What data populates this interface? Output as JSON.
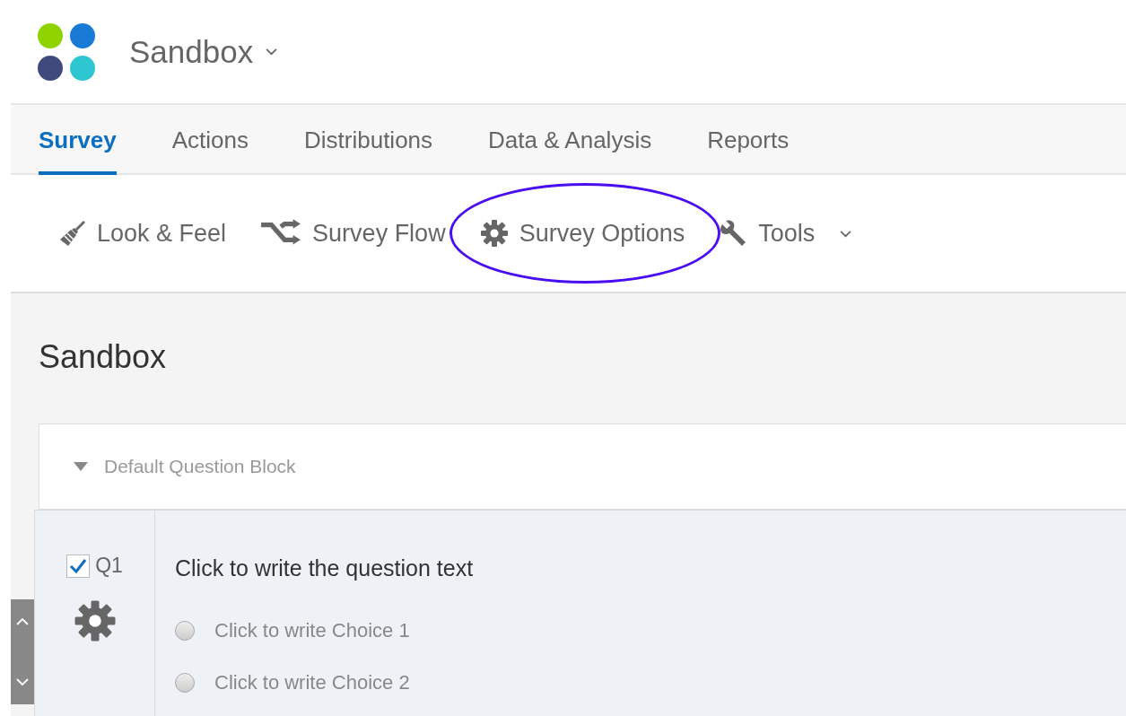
{
  "project": {
    "title": "Sandbox",
    "dropdown": true
  },
  "tabs": [
    {
      "label": "Survey",
      "selected": true
    },
    {
      "label": "Actions",
      "selected": false
    },
    {
      "label": "Distributions",
      "selected": false
    },
    {
      "label": "Data & Analysis",
      "selected": false
    },
    {
      "label": "Reports",
      "selected": false
    }
  ],
  "toolbar": [
    {
      "kind": "brush",
      "label": "Look & Feel",
      "circled": false,
      "dropdown": false
    },
    {
      "kind": "flow",
      "label": "Survey Flow",
      "circled": false,
      "dropdown": false
    },
    {
      "kind": "gear",
      "label": "Survey Options",
      "circled": true,
      "dropdown": false
    },
    {
      "kind": "wrench",
      "label": "Tools",
      "circled": false,
      "dropdown": true
    }
  ],
  "survey_title": "Sandbox",
  "block": {
    "title": "Default Question Block",
    "expanded": true,
    "question": {
      "number": "Q1",
      "checked": true,
      "text": "Click to write the question text",
      "choices": [
        {
          "label": "Click to write Choice 1",
          "selected": false
        },
        {
          "label": "Click to write Choice 2",
          "selected": false
        }
      ]
    }
  }
}
